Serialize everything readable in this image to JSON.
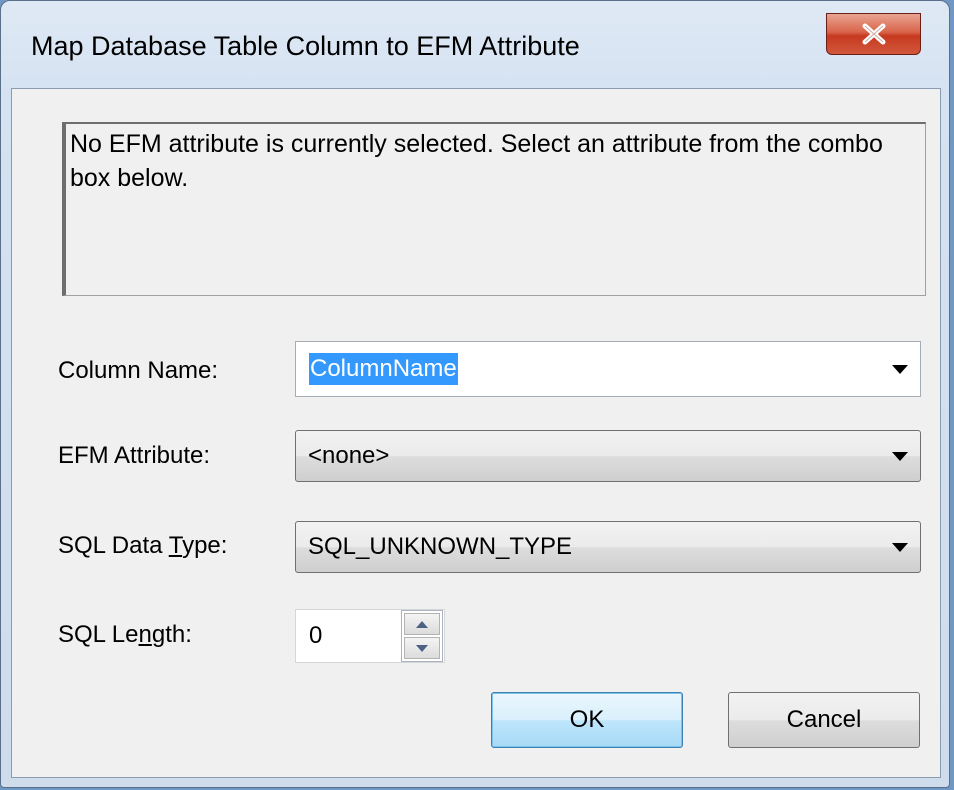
{
  "window": {
    "title": "Map Database Table Column to EFM Attribute",
    "close_glyph": "X"
  },
  "info_text": "No EFM attribute is currently selected. Select an attribute from the combo box below.",
  "fields": {
    "column_name": {
      "label": "Column Name:",
      "value": "ColumnName"
    },
    "efm_attribute": {
      "label": "EFM Attribute:",
      "value": "<none>"
    },
    "sql_data_type": {
      "label_pre": "SQL Data ",
      "label_mnemonic": "T",
      "label_post": "ype:",
      "value": "SQL_UNKNOWN_TYPE"
    },
    "sql_length": {
      "label_pre": "SQL Le",
      "label_mnemonic": "n",
      "label_post": "gth:",
      "value": "0"
    }
  },
  "buttons": {
    "ok": "OK",
    "cancel": "Cancel"
  },
  "icons": {
    "close": "close-icon",
    "dropdown": "chevron-down-icon",
    "spin_up": "arrow-up-icon",
    "spin_down": "arrow-down-icon"
  },
  "colors": {
    "selection": "#3399ff",
    "close_button": "#c6391f",
    "default_button_border": "#3c7fb1"
  }
}
